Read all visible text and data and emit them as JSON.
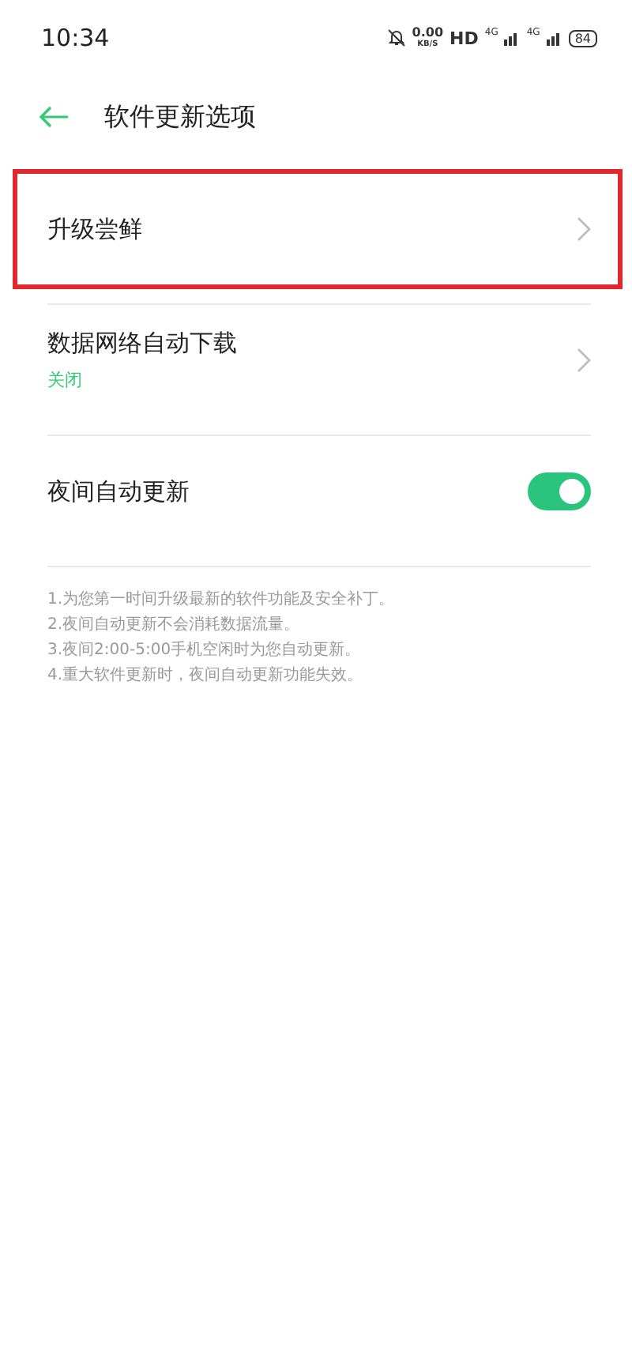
{
  "status_bar": {
    "time": "10:34",
    "speed": "0.00",
    "speed_unit": "KB/S",
    "hd": "HD",
    "network_1": "4G",
    "network_2": "4G",
    "battery": "84"
  },
  "header": {
    "title": "软件更新选项"
  },
  "items": [
    {
      "kind": "link",
      "label": "升级尝鲜",
      "highlighted": true
    },
    {
      "kind": "link",
      "label": "数据网络自动下载",
      "value": "关闭",
      "highlighted": false
    },
    {
      "kind": "toggle",
      "label": "夜间自动更新",
      "on": true,
      "highlighted": false
    }
  ],
  "notes": [
    "1.为您第一时间升级最新的软件功能及安全补丁。",
    "2.夜间自动更新不会消耗数据流量。",
    "3.夜间2:00-5:00手机空闲时为您自动更新。",
    "4.重大软件更新时，夜间自动更新功能失效。"
  ]
}
